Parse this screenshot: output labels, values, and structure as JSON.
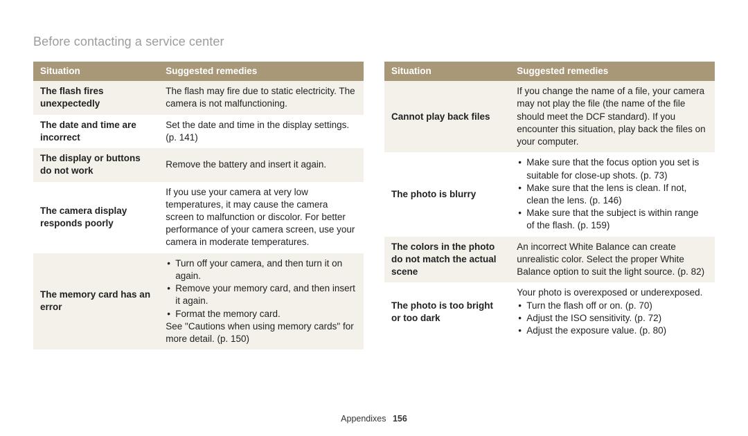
{
  "page_title": "Before contacting a service center",
  "headers": {
    "situation": "Situation",
    "remedies": "Suggested remedies"
  },
  "footer": {
    "section": "Appendixes",
    "page": "156"
  },
  "left": [
    {
      "situation": "The flash fires unexpectedly",
      "remedy_text": "The flash may fire due to static electricity. The camera is not malfunctioning.",
      "alt": true
    },
    {
      "situation": "The date and time are incorrect",
      "remedy_text": "Set the date and time in the display settings. (p. 141)",
      "alt": false
    },
    {
      "situation": "The display or buttons do not work",
      "remedy_text": "Remove the battery and insert it again.",
      "alt": true
    },
    {
      "situation": "The camera display responds poorly",
      "remedy_text": "If you use your camera at very low temperatures, it may cause the camera screen to malfunction or discolor. For better performance of your camera screen, use your camera in moderate temperatures.",
      "alt": false
    },
    {
      "situation": "The memory card has an error",
      "remedy_bullets": [
        "Turn off your camera, and then turn it on again.",
        "Remove your memory card, and then insert it again.",
        "Format the memory card."
      ],
      "remedy_suffix": "See \"Cautions when using memory cards\" for more detail. (p. 150)",
      "alt": true
    }
  ],
  "right": [
    {
      "situation": "Cannot play back files",
      "remedy_text": "If you change the name of a file, your camera may not play the file (the name of the file should meet the DCF standard). If you encounter this situation, play back the files on your computer.",
      "alt": true
    },
    {
      "situation": "The photo is blurry",
      "remedy_bullets": [
        "Make sure that the focus option you set is suitable for close-up shots. (p. 73)",
        "Make sure that the lens is clean. If not, clean the lens. (p. 146)",
        "Make sure that the subject is within range of the flash. (p. 159)"
      ],
      "alt": false
    },
    {
      "situation": "The colors in the photo do not match the actual scene",
      "remedy_text": "An incorrect White Balance can create unrealistic color. Select the proper White Balance option to suit the light source. (p. 82)",
      "alt": true
    },
    {
      "situation": "The photo is too bright or too dark",
      "remedy_prefix": "Your photo is overexposed or underexposed.",
      "remedy_bullets": [
        "Turn the flash off or on. (p. 70)",
        "Adjust the ISO sensitivity. (p. 72)",
        "Adjust the exposure value. (p. 80)"
      ],
      "alt": false
    }
  ]
}
